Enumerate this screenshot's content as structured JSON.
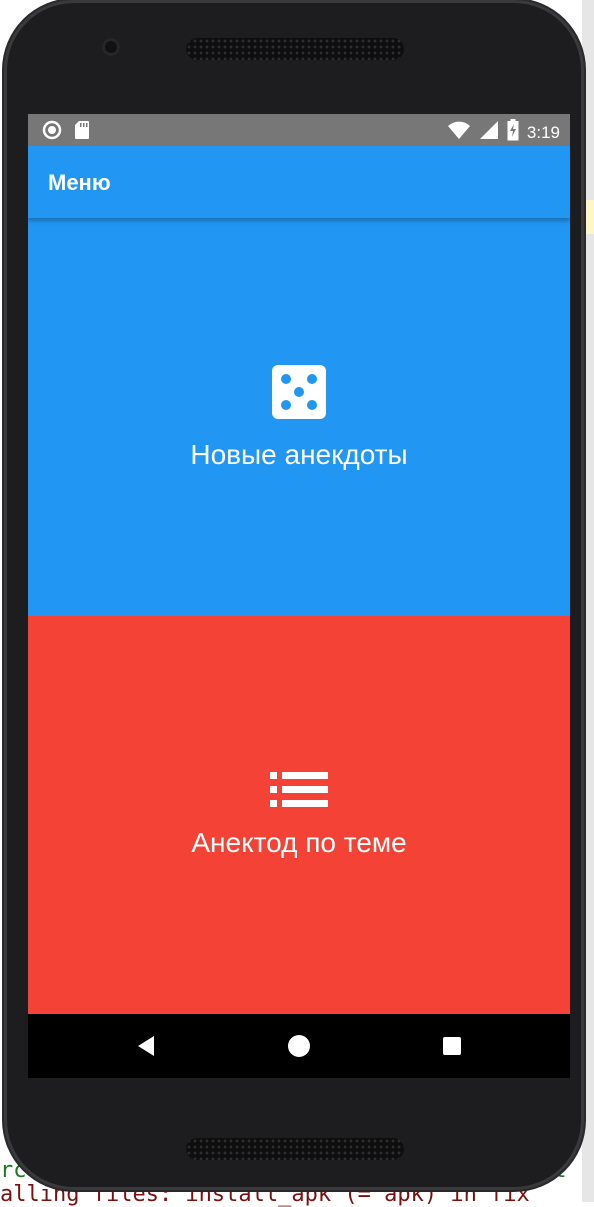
{
  "background_ide": {
    "line1": "rc",
    "line1_right": "et",
    "line2": "alling files: install_apk (= apk) in fix"
  },
  "status_bar": {
    "time": "3:19",
    "left_icons": [
      "notification-circle-icon",
      "sd-card-icon"
    ],
    "right_icons": [
      "wifi-icon",
      "signal-icon",
      "battery-charging-icon"
    ]
  },
  "app_bar": {
    "title": "Меню"
  },
  "panels": [
    {
      "label": "Новые анекдоты",
      "icon": "dice-icon",
      "color": "#2196f3"
    },
    {
      "label": "Анектод по теме",
      "icon": "list-icon",
      "color": "#f44336"
    }
  ],
  "nav_bar": {
    "buttons": [
      "back-icon",
      "home-icon",
      "recents-icon"
    ]
  }
}
